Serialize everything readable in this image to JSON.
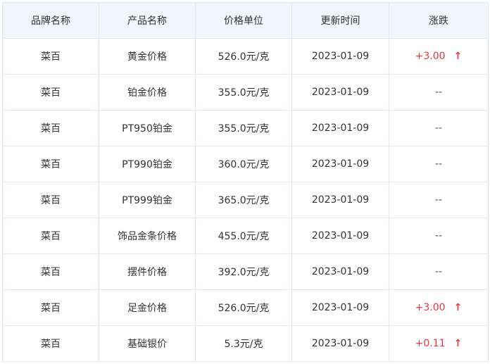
{
  "table": {
    "headers": {
      "brand": "品牌名称",
      "product": "产品名称",
      "unit_price": "价格单位",
      "updated": "更新时间",
      "change": "涨跌"
    },
    "rows": [
      {
        "brand": "菜百",
        "product": "黄金价格",
        "unit_price": "526.0元/克",
        "updated": "2023-01-09",
        "change": "+3.00",
        "trend": "up"
      },
      {
        "brand": "菜百",
        "product": "铂金价格",
        "unit_price": "355.0元/克",
        "updated": "2023-01-09",
        "change": "--",
        "trend": "none"
      },
      {
        "brand": "菜百",
        "product": "PT950铂金",
        "unit_price": "355.0元/克",
        "updated": "2023-01-09",
        "change": "--",
        "trend": "none"
      },
      {
        "brand": "菜百",
        "product": "PT990铂金",
        "unit_price": "360.0元/克",
        "updated": "2023-01-09",
        "change": "--",
        "trend": "none"
      },
      {
        "brand": "菜百",
        "product": "PT999铂金",
        "unit_price": "365.0元/克",
        "updated": "2023-01-09",
        "change": "--",
        "trend": "none"
      },
      {
        "brand": "菜百",
        "product": "饰品金条价格",
        "unit_price": "455.0元/克",
        "updated": "2023-01-09",
        "change": "--",
        "trend": "none"
      },
      {
        "brand": "菜百",
        "product": "摆件价格",
        "unit_price": "392.0元/克",
        "updated": "2023-01-09",
        "change": "--",
        "trend": "none"
      },
      {
        "brand": "菜百",
        "product": "足金价格",
        "unit_price": "526.0元/克",
        "updated": "2023-01-09",
        "change": "+3.00",
        "trend": "up"
      },
      {
        "brand": "菜百",
        "product": "基础银价",
        "unit_price": "5.3元/克",
        "updated": "2023-01-09",
        "change": "+0.11",
        "trend": "up"
      }
    ]
  },
  "icons": {
    "up": "arrow-up-icon"
  },
  "colors": {
    "header_bg": "#f0f6fd",
    "border": "#dfe9f5",
    "up": "#e8363c"
  }
}
